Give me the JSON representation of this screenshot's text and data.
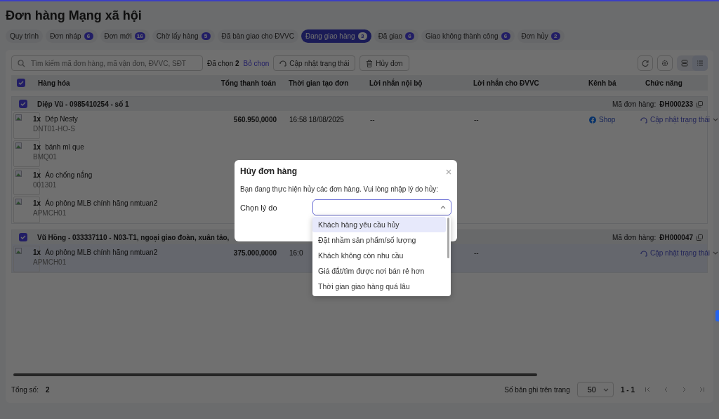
{
  "page": {
    "title": "Đơn hàng Mạng xã hội"
  },
  "tabs": [
    {
      "label": "Quy trình",
      "selected": false
    },
    {
      "label": "Đơn nháp",
      "count": "6",
      "selected": false
    },
    {
      "label": "Đơn mới",
      "count": "16",
      "selected": false
    },
    {
      "label": "Chờ lấy hàng",
      "count": "5",
      "selected": false
    },
    {
      "label": "Đã bàn giao cho ĐVVC",
      "selected": false
    },
    {
      "label": "Đang giao hàng",
      "count": "3",
      "selected": true
    },
    {
      "label": "Đã giao",
      "count": "6",
      "selected": false
    },
    {
      "label": "Giao không thành công",
      "count": "6",
      "selected": false
    },
    {
      "label": "Đơn hủy",
      "count": "2",
      "selected": false
    }
  ],
  "toolbar": {
    "search_placeholder": "Tìm kiếm mã đơn hàng, mã vận đơn, ĐVVC, SĐT",
    "selected_label": "Đã chọn",
    "selected_count": "2",
    "clear": "Bỏ chọn",
    "update_status": "Cập nhật trạng thái",
    "cancel": "Hủy đơn"
  },
  "table": {
    "all_checked": true,
    "columns": [
      "Hàng hóa",
      "Tổng thanh toán",
      "Thời gian tạo đơn",
      "Lời nhắn nội bộ",
      "Lời nhắn cho ĐVVC",
      "Kênh bá",
      "Chức năng"
    ],
    "orders": [
      {
        "checked": true,
        "customer": "Diệp Vũ - 0985410254 - số 1",
        "code_label": "Mã đơn hàng:",
        "code": "ĐH000233",
        "total": "560.950,0000",
        "created": "16:58 18/08/2025",
        "internal_note": "--",
        "carrier_note": "--",
        "channel": "Shop",
        "action": "Cập nhật trạng thái",
        "highlighted": false,
        "items": [
          {
            "qty": "1x",
            "name": "Dép Nesty",
            "sku": "DNT01-HO-S"
          },
          {
            "qty": "1x",
            "name": "bánh mì que",
            "sku": "BMQ01"
          },
          {
            "qty": "1x",
            "name": "Áo chống nắng",
            "sku": "001301"
          },
          {
            "qty": "1x",
            "name": "Áo phông MLB chính hãng nmtuan2",
            "sku": "APMCH01"
          }
        ]
      },
      {
        "checked": true,
        "customer": "Vũ Hồng - 033337110 - N03-T1, ngoại giao đoàn, xuân tảo,",
        "code_label": "Mã đơn hàng:",
        "code": "ĐH000047",
        "total": "375.000,0000",
        "created": "16:0",
        "carrier_note": "--",
        "action": "Cập nhật trạng thái",
        "highlighted": true,
        "items": [
          {
            "qty": "1x",
            "name": "Áo phông MLB chính hãng nmtuan2",
            "sku": "APMCH01"
          }
        ]
      }
    ]
  },
  "footer": {
    "total_label": "Tổng số:",
    "total": "2",
    "per_page_label": "Số bản ghi trên trang",
    "per_page": "50",
    "range": "1 - 1"
  },
  "modal": {
    "title": "Hủy đơn hàng",
    "message": "Bạn đang thực hiện hủy các đơn hàng. Vui lòng nhập lý do hủy:",
    "field_label": "Chọn lý do",
    "options": [
      {
        "label": "Khách hàng yêu cầu hủy",
        "selected": true
      },
      {
        "label": "Đặt nhầm sản phẩm/số lượng",
        "selected": false
      },
      {
        "label": "Khách không còn nhu cầu",
        "selected": false
      },
      {
        "label": "Giá đắt/tìm được nơi bán rẻ hơn",
        "selected": false
      },
      {
        "label": "Thời gian giao hàng quá lâu",
        "selected": false
      }
    ]
  }
}
